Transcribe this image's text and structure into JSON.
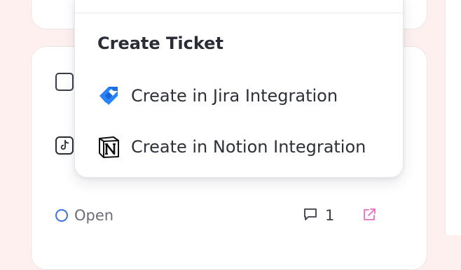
{
  "dropdown": {
    "section_title": "Create Ticket",
    "items": [
      {
        "label": "Create in Jira Integration",
        "icon": "jira-icon"
      },
      {
        "label": "Create in Notion Integration",
        "icon": "notion-icon"
      }
    ]
  },
  "card": {
    "status_label": "Open",
    "status_icon": "status-circle-icon",
    "comment_count": "1",
    "comment_icon": "comment-icon",
    "external_icon": "external-link-icon",
    "platform_icon": "tiktok-icon"
  },
  "colors": {
    "status_blue": "#3b72d9",
    "jira_blue": "#2684ff",
    "external_pink": "#e86fc0",
    "background": "#fdf0ef"
  }
}
